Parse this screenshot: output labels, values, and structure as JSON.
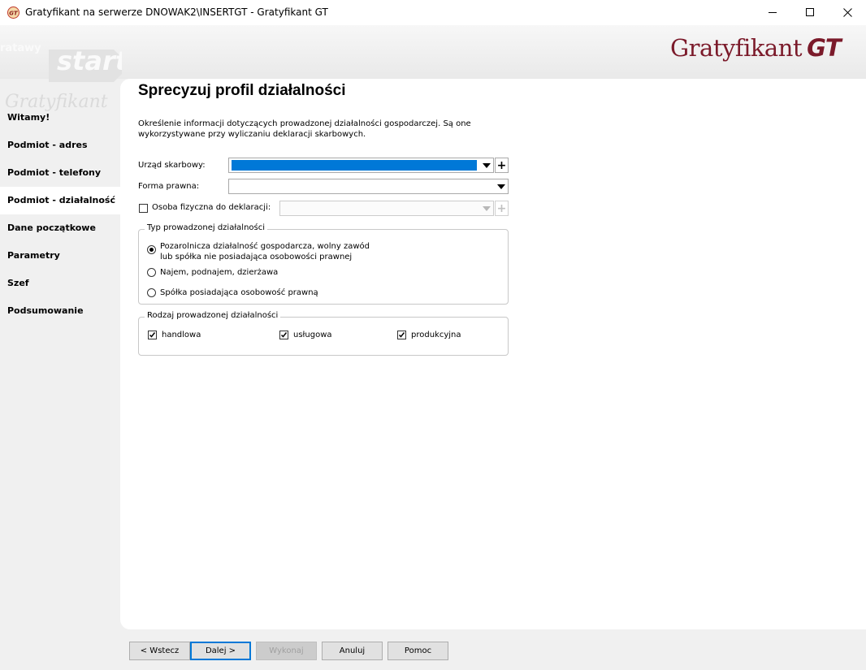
{
  "window": {
    "title": "Gratyfikant na serwerze DNOWAK2\\INSERTGT - Gratyfikant GT",
    "icon": "gt-app-icon"
  },
  "logo": {
    "text": "Gratyfikant",
    "suffix": "GT",
    "color": "#7b1a2a"
  },
  "sidebar": {
    "items": [
      {
        "label": "Witamy!",
        "active": false
      },
      {
        "label": "Podmiot - adres",
        "active": false
      },
      {
        "label": "Podmiot - telefony",
        "active": false
      },
      {
        "label": "Podmiot - działalność",
        "active": true
      },
      {
        "label": "Dane początkowe",
        "active": false
      },
      {
        "label": "Parametry",
        "active": false
      },
      {
        "label": "Szef",
        "active": false
      },
      {
        "label": "Podsumowanie",
        "active": false
      }
    ]
  },
  "page": {
    "heading": "Sprecyzuj profil działalności",
    "description": "Określenie informacji dotyczących prowadzonej działalności gospodarczej. Są one wykorzystywane przy wyliczaniu deklaracji skarbowych."
  },
  "form": {
    "urzad_label": "Urząd skarbowy:",
    "urzad_value": "",
    "forma_label": "Forma prawna:",
    "forma_value": "",
    "osoba_label": "Osoba fizyczna do deklaracji:",
    "osoba_checked": false,
    "osoba_value": ""
  },
  "typ_group": {
    "legend": "Typ prowadzonej działalności",
    "options": [
      {
        "line1": "Pozarolnicza działalność gospodarcza, wolny zawód",
        "line2": "lub spółka nie posiadająca osobowości prawnej",
        "selected": true
      },
      {
        "line1": "Najem, podnajem, dzierżawa",
        "selected": false
      },
      {
        "line1": "Spółka posiadająca osobowość prawną",
        "selected": false
      }
    ]
  },
  "rodzaj_group": {
    "legend": "Rodzaj prowadzonej działalności",
    "options": [
      {
        "label": "handlowa",
        "checked": true
      },
      {
        "label": "usługowa",
        "checked": true
      },
      {
        "label": "produkcyjna",
        "checked": true
      }
    ]
  },
  "buttons": {
    "back": "< Wstecz",
    "next": "Dalej >",
    "execute": "Wykonaj",
    "cancel": "Anuluj",
    "help": "Pomoc"
  },
  "colors": {
    "accent": "#0078d7",
    "brand": "#7b1a2a"
  }
}
